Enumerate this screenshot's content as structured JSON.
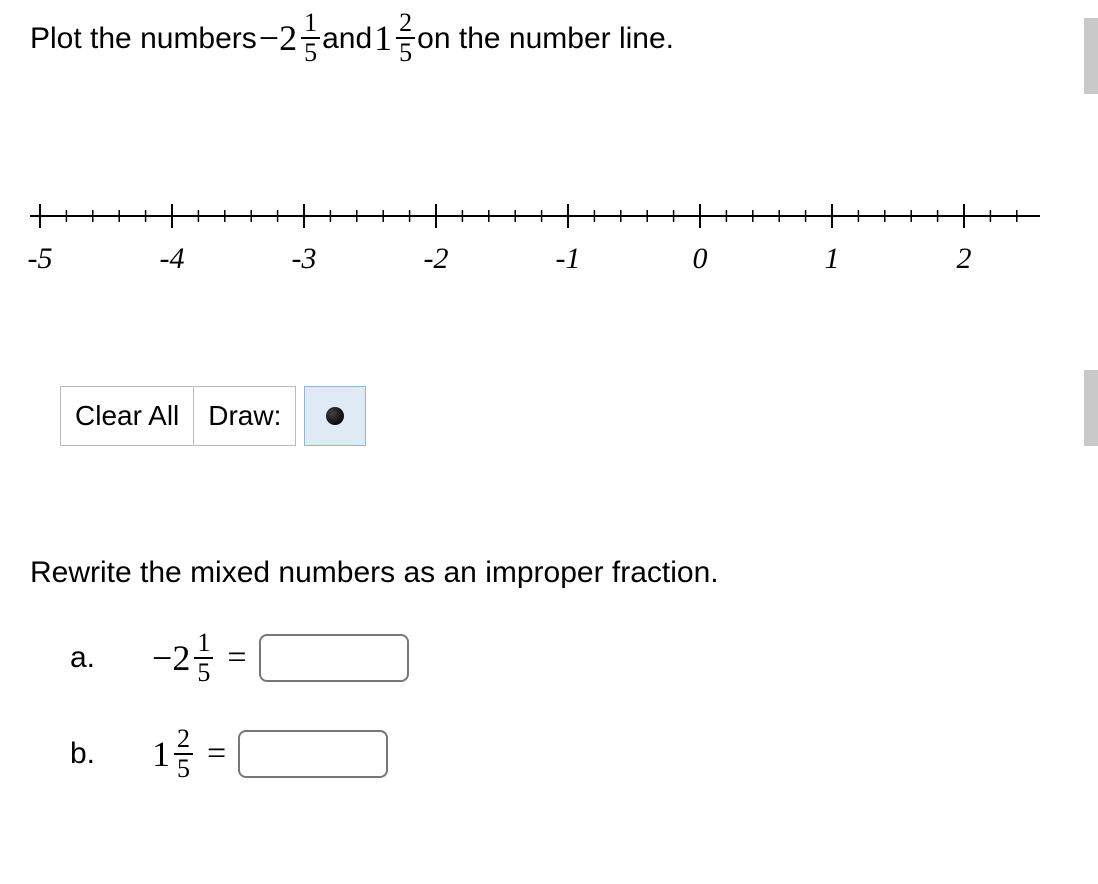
{
  "question": {
    "prefix": "Plot the numbers ",
    "n1": {
      "sign": "−",
      "whole": "2",
      "num": "1",
      "den": "5"
    },
    "mid": "and ",
    "n2": {
      "sign": "",
      "whole": "1",
      "num": "2",
      "den": "5"
    },
    "suffix": " on the number line."
  },
  "numberline": {
    "min": -5,
    "max": 2.5,
    "majors": [
      -5,
      -4,
      -3,
      -2,
      -1,
      0,
      1,
      2
    ],
    "labels": [
      "-5",
      "-4",
      "-3",
      "-2",
      "-1",
      "0",
      "1",
      "2"
    ]
  },
  "toolbar": {
    "clear_label": "Clear All",
    "draw_label": "Draw:",
    "tool": "point"
  },
  "rewrite": {
    "prompt": "Rewrite the mixed numbers as an improper fraction.",
    "a": {
      "letter": "a.",
      "sign": "−",
      "whole": "2",
      "num": "1",
      "den": "5",
      "value": ""
    },
    "b": {
      "letter": "b.",
      "sign": "",
      "whole": "1",
      "num": "2",
      "den": "5",
      "value": ""
    }
  },
  "chart_data": {
    "type": "numberline",
    "axis_range": [
      -5,
      2.5
    ],
    "major_ticks": [
      -5,
      -4,
      -3,
      -2,
      -1,
      0,
      1,
      2
    ],
    "minor_tick_interval": 0.2,
    "points_to_plot": [
      -2.2,
      1.4
    ],
    "plotted_points": []
  }
}
